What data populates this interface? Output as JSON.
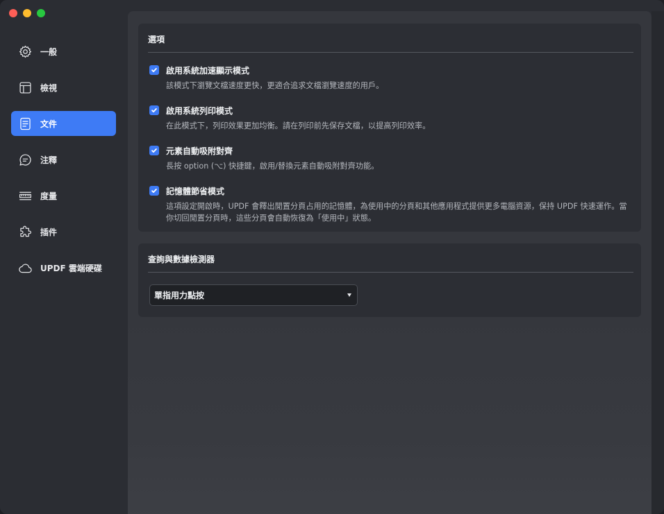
{
  "window_controls": [
    "close",
    "minimize",
    "maximize"
  ],
  "sidebar": {
    "items": [
      {
        "label": "一般",
        "icon": "gear-icon",
        "active": false
      },
      {
        "label": "檢視",
        "icon": "layout-icon",
        "active": false
      },
      {
        "label": "文件",
        "icon": "document-icon",
        "active": true
      },
      {
        "label": "注釋",
        "icon": "comment-icon",
        "active": false
      },
      {
        "label": "度量",
        "icon": "ruler-icon",
        "active": false
      },
      {
        "label": "插件",
        "icon": "puzzle-icon",
        "active": false
      },
      {
        "label": "UPDF 雲端硬碟",
        "icon": "cloud-icon",
        "active": false
      }
    ]
  },
  "options_section": {
    "title": "選項",
    "options": [
      {
        "label": "啟用系統加速顯示模式",
        "description": "該模式下瀏覽文檔速度更快，更適合追求文檔瀏覽速度的用戶。",
        "checked": true
      },
      {
        "label": "啟用系統列印模式",
        "description": "在此模式下，列印效果更加均衡。請在列印前先保存文檔，以提高列印效率。",
        "checked": true
      },
      {
        "label": "元素自動吸附對齊",
        "description": "長按 option (⌥) 快捷鍵，啟用/替換元素自動吸附對齊功能。",
        "checked": true
      },
      {
        "label": "記憶體節省模式",
        "description": "這項設定開啟時，UPDF 會釋出閒置分頁占用的記憶體，為使用中的分頁和其他應用程式提供更多電腦資源，保持 UPDF 快速運作。當你切回閒置分頁時，這些分頁會自動恢復為「使用中」狀態。",
        "checked": true
      }
    ]
  },
  "lookup_section": {
    "title": "查詢與數據檢測器",
    "select_value": "單指用力點按"
  },
  "colors": {
    "accent": "#3e7bf5",
    "sidebar_bg": "#2b2d33",
    "card_bg": "#2c2e34"
  }
}
